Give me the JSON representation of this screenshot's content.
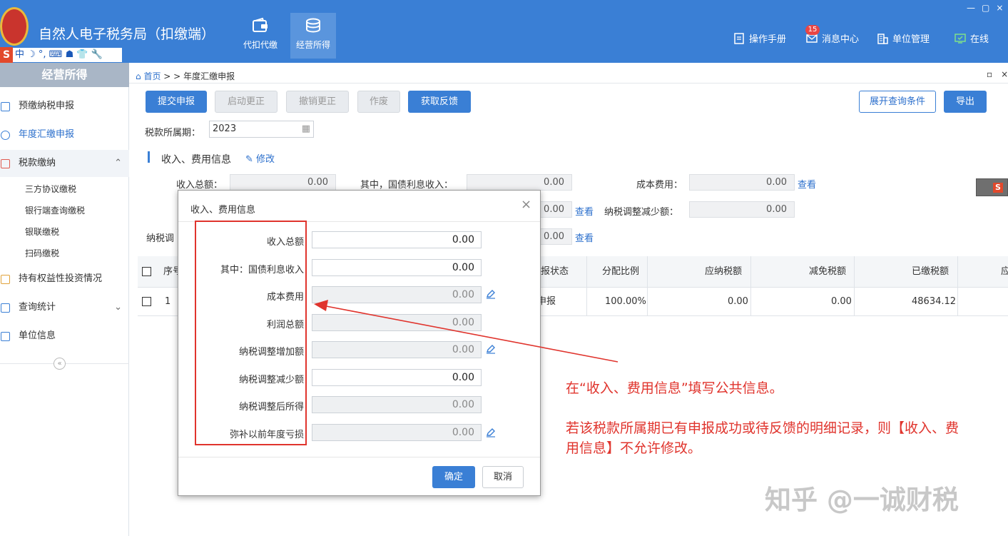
{
  "header": {
    "app_title": "自然人电子税务局（扣缴端）",
    "nav": [
      {
        "label": "代扣代缴",
        "icon": "wallet-icon"
      },
      {
        "label": "经营所得",
        "icon": "coins-icon"
      }
    ],
    "badge_count": "15",
    "right_items": [
      {
        "label": "操作手册",
        "icon": "manual-icon"
      },
      {
        "label": "消息中心",
        "icon": "mail-icon"
      },
      {
        "label": "单位管理",
        "icon": "building-icon"
      },
      {
        "label": "在线",
        "icon": "online-icon"
      }
    ],
    "window_controls": "—▢×"
  },
  "ime_toolbar": {
    "logo": "S",
    "text": "中 ☽ °, ⌨ ☗ 👕 🔧"
  },
  "sidebar": {
    "title": "经营所得",
    "items": [
      {
        "label": "预缴纳税申报"
      },
      {
        "label": "年度汇缴申报"
      },
      {
        "label": "税款缴纳"
      },
      {
        "label": "三方协议缴税"
      },
      {
        "label": "银行端查询缴税"
      },
      {
        "label": "银联缴税"
      },
      {
        "label": "扫码缴税"
      },
      {
        "label": "持有权益性投资情况"
      },
      {
        "label": "查询统计"
      },
      {
        "label": "单位信息"
      }
    ],
    "collapse_glyph": "«"
  },
  "breadcrumb": {
    "home": "首页",
    "sep": "> >",
    "current": "年度汇缴申报",
    "tab_controls": "▫×"
  },
  "toolbar": {
    "submit": "提交申报",
    "start_correction": "启动更正",
    "cancel_correction": "撤销更正",
    "void": "作废",
    "get_feedback": "获取反馈",
    "expand_query": "展开查询条件",
    "export": "导出"
  },
  "period": {
    "label": "税款所属期：",
    "value": "2023"
  },
  "section": {
    "title": "收入、费用信息",
    "edit_link": "修改"
  },
  "summary": {
    "total_income_label": "收入总额：",
    "total_income": "0.00",
    "bond_interest_label": "其中，国债利息收入：",
    "bond_interest": "0.00",
    "cost_label": "成本费用：",
    "cost": "0.00",
    "view_link": "查看",
    "row2_value": "0.00",
    "decrease_label": "纳税调整减少额：",
    "decrease": "0.00",
    "row3_label_partial": "纳税调",
    "row3_value": "0.00"
  },
  "table": {
    "headers": [
      "序号",
      "报状态",
      "分配比例",
      "应纳税额",
      "减免税额",
      "已缴税额",
      "应"
    ],
    "rows": [
      {
        "seq": "1",
        "status": "待申报",
        "ratio": "100.00%",
        "tax_payable": "0.00",
        "tax_relief": "0.00",
        "tax_paid": "48634.12"
      }
    ]
  },
  "dialog": {
    "title": "收入、费用信息",
    "close": "×",
    "fields": [
      {
        "label": "收入总额",
        "value": "0.00",
        "readonly": false,
        "editable_icon": false
      },
      {
        "label": "其中：国债利息收入",
        "value": "0.00",
        "readonly": false,
        "editable_icon": false
      },
      {
        "label": "成本费用",
        "value": "0.00",
        "readonly": true,
        "editable_icon": true
      },
      {
        "label": "利润总额",
        "value": "0.00",
        "readonly": true,
        "editable_icon": false
      },
      {
        "label": "纳税调整增加额",
        "value": "0.00",
        "readonly": true,
        "editable_icon": true
      },
      {
        "label": "纳税调整减少额",
        "value": "0.00",
        "readonly": false,
        "editable_icon": false
      },
      {
        "label": "纳税调整后所得",
        "value": "0.00",
        "readonly": true,
        "editable_icon": false
      },
      {
        "label": "弥补以前年度亏损",
        "value": "0.00",
        "readonly": true,
        "editable_icon": true
      }
    ],
    "confirm": "确定",
    "cancel": "取消"
  },
  "annotation": {
    "line1": "在“收入、费用信息”填写公共信息。",
    "line2a": "若该税款所属期已有申报成功或待反馈的明细记录，则【收入、费",
    "line2b": "用信息】不允许修改。",
    "color": "#e0342d"
  },
  "watermark": "知乎 @一诚财税"
}
